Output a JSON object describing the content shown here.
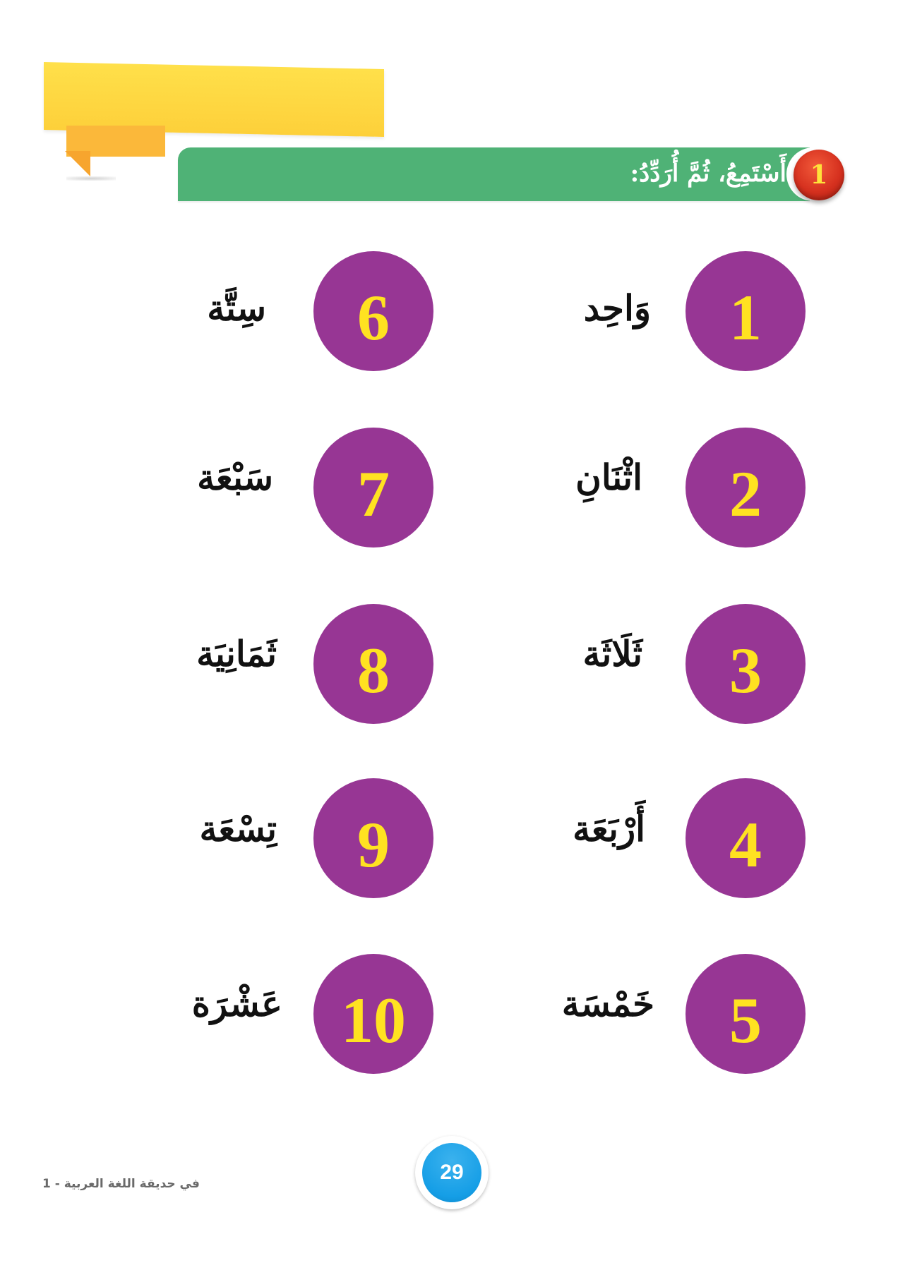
{
  "exercise": {
    "number": "1",
    "instruction": "أَسْتَمِعُ، ثُمَّ أُرَدِّدُ:"
  },
  "numbers": [
    {
      "digit": "1",
      "word": "وَاحِد"
    },
    {
      "digit": "2",
      "word": "اثْنَانِ"
    },
    {
      "digit": "3",
      "word": "ثَلَاثَة"
    },
    {
      "digit": "4",
      "word": "أَرْبَعَة"
    },
    {
      "digit": "5",
      "word": "خَمْسَة"
    },
    {
      "digit": "6",
      "word": "سِتَّة"
    },
    {
      "digit": "7",
      "word": "سَبْعَة"
    },
    {
      "digit": "8",
      "word": "ثَمَانِيَة"
    },
    {
      "digit": "9",
      "word": "تِسْعَة"
    },
    {
      "digit": "10",
      "word": "عَشْرَة"
    }
  ],
  "page_number": "29",
  "footer": "في حديقة اللغة العربية - 1",
  "colors": {
    "circle": "#973694",
    "digit": "#ffe221",
    "bar": "#4fb276",
    "ribbon": "#fdd03a",
    "badge": "#d6311f",
    "page_badge": "#159ee6"
  }
}
